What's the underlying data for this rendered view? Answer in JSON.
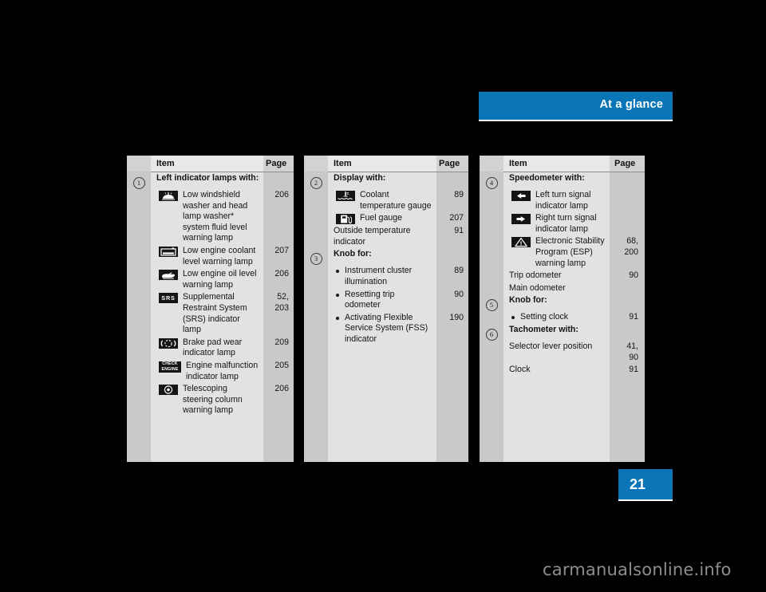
{
  "header": {
    "title": "At a glance"
  },
  "footer": {
    "page_number": "21",
    "watermark": "carmanualsonline.info"
  },
  "columns": [
    {
      "id": "column-1",
      "head": {
        "item": "Item",
        "page": "Page"
      },
      "rows": [
        {
          "kind": "heading",
          "num": "1",
          "text": "Left indicator lamps with:",
          "page": ""
        },
        {
          "kind": "icon",
          "icon": "windshield-washer-fluid-icon",
          "text": "Low windshield washer and head lamp washer* system fluid level warning lamp",
          "page": "206"
        },
        {
          "kind": "icon",
          "icon": "engine-coolant-level-icon",
          "text": "Low engine coolant level warning lamp",
          "page": "207"
        },
        {
          "kind": "icon",
          "icon": "engine-oil-level-icon",
          "text": "Low engine oil level warning lamp",
          "page": "206"
        },
        {
          "kind": "icon",
          "icon": "srs-airbag-icon",
          "icon_label": "SRS",
          "text": "Supplemental Restraint System (SRS) indicator lamp",
          "page": "52, 203"
        },
        {
          "kind": "icon",
          "icon": "brake-pad-wear-icon",
          "text": "Brake pad wear indicator lamp",
          "page": "209"
        },
        {
          "kind": "icon",
          "icon": "check-engine-icon",
          "icon_label_1": "CHECK",
          "icon_label_2": "ENGINE",
          "text": "Engine malfunction indicator lamp",
          "page": "205"
        },
        {
          "kind": "icon",
          "icon": "telescoping-steering-column-icon",
          "text": "Telescoping steering column warning lamp",
          "page": "206"
        }
      ]
    },
    {
      "id": "column-2",
      "head": {
        "item": "Item",
        "page": "Page"
      },
      "rows": [
        {
          "kind": "heading",
          "num": "2",
          "text": "Display with:",
          "page": ""
        },
        {
          "kind": "icon",
          "icon": "coolant-temperature-icon",
          "text": "Coolant temperature gauge",
          "page": "89"
        },
        {
          "kind": "icon",
          "icon": "fuel-pump-icon",
          "text": "Fuel gauge",
          "page": "207"
        },
        {
          "kind": "plain",
          "text": "Outside temperature indicator",
          "page": "91"
        },
        {
          "kind": "heading",
          "num": "3",
          "text": "Knob for:",
          "page": ""
        },
        {
          "kind": "bullet",
          "text": "Instrument cluster illumination",
          "page": "89"
        },
        {
          "kind": "bullet",
          "text": "Resetting trip odometer",
          "page": "90"
        },
        {
          "kind": "bullet",
          "text": "Activating Flexible Service System (FSS) indicator",
          "page": "190"
        }
      ]
    },
    {
      "id": "column-3",
      "head": {
        "item": "Item",
        "page": "Page"
      },
      "rows": [
        {
          "kind": "heading",
          "num": "4",
          "text": "Speedometer with:",
          "page": ""
        },
        {
          "kind": "icon",
          "icon": "left-turn-signal-icon",
          "text": "Left turn signal indicator lamp",
          "page": ""
        },
        {
          "kind": "icon",
          "icon": "right-turn-signal-icon",
          "text": "Right turn signal indicator lamp",
          "page": ""
        },
        {
          "kind": "icon",
          "icon": "esp-warning-triangle-icon",
          "text": "Electronic Stability Program (ESP) warning lamp",
          "page": "68, 200"
        },
        {
          "kind": "plain",
          "text": "Trip odometer",
          "page": "90"
        },
        {
          "kind": "plain",
          "text": "Main odometer",
          "page": ""
        },
        {
          "kind": "heading",
          "num": "5",
          "text": "Knob for:",
          "page": ""
        },
        {
          "kind": "bullet",
          "text": "Setting clock",
          "page": "91"
        },
        {
          "kind": "heading",
          "num": "6",
          "text": "Tachometer with:",
          "page": ""
        },
        {
          "kind": "plain",
          "text": "Selector lever position",
          "page": "41, 90"
        },
        {
          "kind": "plain",
          "text": "Clock",
          "page": "91"
        }
      ]
    }
  ],
  "colors": {
    "accent": "#0a76b8",
    "panel": "#e2e2e2",
    "gutter": "#c9c9c9",
    "icon": "#151515"
  }
}
